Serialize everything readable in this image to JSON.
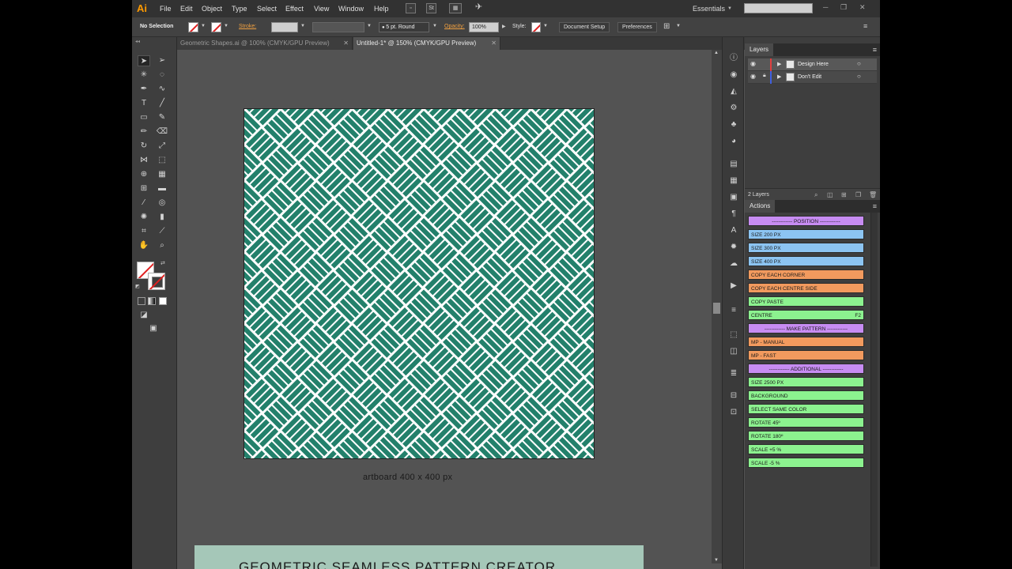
{
  "app": {
    "logo": "Ai",
    "menu": [
      "File",
      "Edit",
      "Object",
      "Type",
      "Select",
      "Effect",
      "View",
      "Window",
      "Help"
    ],
    "workspace": "Essentials",
    "search_placeholder": ""
  },
  "control_bar": {
    "selection_label": "No Selection",
    "stroke_label": "Stroke:",
    "brush_value": "5 pt. Round",
    "opacity_label": "Opacity:",
    "opacity_value": "100%",
    "style_label": "Style:",
    "document_setup": "Document Setup",
    "preferences": "Preferences"
  },
  "tabs": [
    {
      "label": "Geometric Shapes.ai @ 100% (CMYK/GPU Preview)",
      "active": false
    },
    {
      "label": "Untitled-1* @ 150% (CMYK/GPU Preview)",
      "active": true
    }
  ],
  "canvas": {
    "artboard_caption": "artboard 400 x 400 px",
    "banner_text": "GEOMETRIC SEAMLESS PATTERN CREATOR",
    "pattern_color": "#23806b",
    "banner_color": "#a5c7b8"
  },
  "layers": {
    "title": "Layers",
    "items": [
      {
        "name": "Design Here",
        "color": "#e04040",
        "locked": false
      },
      {
        "name": "Don't Edit",
        "color": "#4060e0",
        "locked": true
      }
    ],
    "count": "2 Layers"
  },
  "actions": {
    "title": "Actions",
    "items": [
      {
        "label": "------------ POSITION ------------",
        "color": "#c78cf2",
        "key": "",
        "center": true
      },
      {
        "label": "SIZE 200 PX",
        "color": "#8cc4f2",
        "key": "",
        "center": false
      },
      {
        "label": "SIZE 300 PX",
        "color": "#8cc4f2",
        "key": "",
        "center": false
      },
      {
        "label": "SIZE 400 PX",
        "color": "#8cc4f2",
        "key": "",
        "center": false
      },
      {
        "label": "COPY EACH CORNER",
        "color": "#f29a5e",
        "key": "",
        "center": false
      },
      {
        "label": "COPY EACH CENTRE SIDE",
        "color": "#f29a5e",
        "key": "",
        "center": false
      },
      {
        "label": "COPY PASTE",
        "color": "#8cf28f",
        "key": "",
        "center": false
      },
      {
        "label": "CENTRE",
        "color": "#8cf28f",
        "key": "F2",
        "center": false
      },
      {
        "label": "------------ MAKE PATTERN ------------",
        "color": "#c78cf2",
        "key": "",
        "center": true
      },
      {
        "label": "MP - MANUAL",
        "color": "#f29a5e",
        "key": "",
        "center": false
      },
      {
        "label": "MP - FAST",
        "color": "#f29a5e",
        "key": "",
        "center": false
      },
      {
        "label": "------------ ADDITIONAL ------------",
        "color": "#c78cf2",
        "key": "",
        "center": true
      },
      {
        "label": "SIZE 2500 PX",
        "color": "#8cf28f",
        "key": "",
        "center": false
      },
      {
        "label": "BACKGROUND",
        "color": "#8cf28f",
        "key": "",
        "center": false
      },
      {
        "label": "SELECT SAME COLOR",
        "color": "#8cf28f",
        "key": "",
        "center": false
      },
      {
        "label": "ROTATE 45º",
        "color": "#8cf28f",
        "key": "",
        "center": false
      },
      {
        "label": "ROTATE 180º",
        "color": "#8cf28f",
        "key": "",
        "center": false
      },
      {
        "label": "SCALE +5 %",
        "color": "#8cf28f",
        "key": "",
        "center": false
      },
      {
        "label": "SCALE -5 %",
        "color": "#8cf28f",
        "key": "",
        "center": false
      }
    ]
  }
}
